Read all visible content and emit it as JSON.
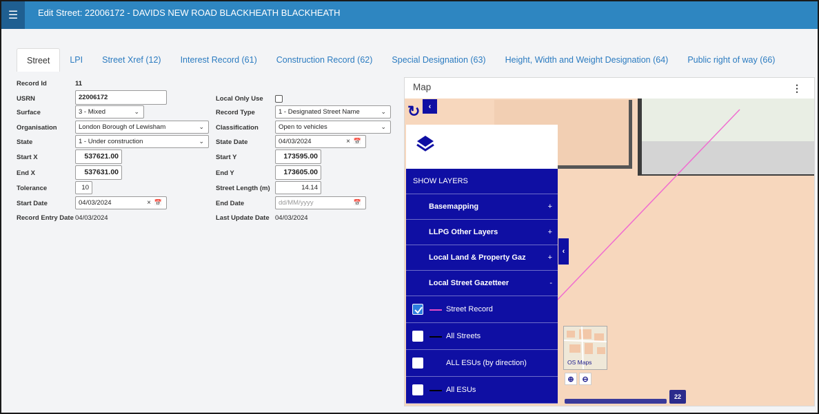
{
  "header": {
    "title": "Edit Street: 22006172 - DAVIDS NEW ROAD BLACKHEATH BLACKHEATH",
    "menu_icon": "hamburger-icon"
  },
  "tabs": [
    {
      "label": "Street"
    },
    {
      "label": "LPI"
    },
    {
      "label": "Street Xref (12)"
    },
    {
      "label": "Interest Record (61)"
    },
    {
      "label": "Construction Record (62)"
    },
    {
      "label": "Special Designation (63)"
    },
    {
      "label": "Height, Width and Weight Designation (64)"
    },
    {
      "label": "Public right of way (66)"
    }
  ],
  "form": {
    "record_id_label": "Record Id",
    "record_id_value": "11",
    "usrn_label": "USRN",
    "usrn_value": "22006172",
    "surface_label": "Surface",
    "surface_value": "3 - Mixed",
    "organisation_label": "Organisation",
    "organisation_value": "London Borough of Lewisham",
    "state_label": "State",
    "state_value": "1 - Under construction",
    "start_x_label": "Start X",
    "start_x_value": "537621.00",
    "end_x_label": "End X",
    "end_x_value": "537631.00",
    "tolerance_label": "Tolerance",
    "tolerance_value": "10",
    "start_date_label": "Start Date",
    "start_date_value": "04/03/2024",
    "record_entry_date_label": "Record Entry Date",
    "record_entry_date_value": "04/03/2024",
    "local_only_use_label": "Local Only Use",
    "record_type_label": "Record Type",
    "record_type_value": "1 - Designated Street Name",
    "classification_label": "Classification",
    "classification_value": "Open to vehicles",
    "state_date_label": "State Date",
    "state_date_value": "04/03/2024",
    "start_y_label": "Start Y",
    "start_y_value": "173595.00",
    "end_y_label": "End Y",
    "end_y_value": "173605.00",
    "street_length_label": "Street Length (m)",
    "street_length_value": "14.14",
    "end_date_label": "End Date",
    "end_date_placeholder": "dd/MM/yyyy",
    "last_update_date_label": "Last Update Date",
    "last_update_date_value": "04/03/2024"
  },
  "map": {
    "title": "Map",
    "show_layers": "SHOW LAYERS",
    "groups": [
      {
        "label": "Basemapping",
        "sign": "+"
      },
      {
        "label": "LLPG Other Layers",
        "sign": "+"
      },
      {
        "label": "Local Land & Property Gaz",
        "sign": "+"
      },
      {
        "label": "Local Street Gazetteer",
        "sign": "-"
      }
    ],
    "layers": [
      {
        "label": "Street Record",
        "checked": true,
        "line_color": "#e64bc6"
      },
      {
        "label": "All Streets",
        "checked": false,
        "line_color": "#000000"
      },
      {
        "label": "ALL ESUs (by direction)",
        "checked": false,
        "line_color": ""
      },
      {
        "label": "All ESUs",
        "checked": false,
        "line_color": "#000000"
      }
    ],
    "thumbnail_label": "OS Maps",
    "scale_value": "22",
    "colors": {
      "panel": "#0f0fa3",
      "map_bg": "#f7d7bd",
      "street_line": "#f06cd0"
    }
  }
}
